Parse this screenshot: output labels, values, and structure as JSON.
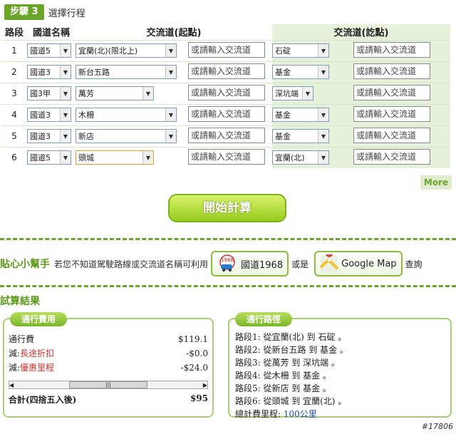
{
  "step": {
    "badge": "步驟 3",
    "title": "選擇行程"
  },
  "table": {
    "headers": {
      "segment": "路段",
      "road": "國道名稱",
      "start": "交流道(起點)",
      "end": "交流道(訖點)"
    },
    "placeholder": "或請輸入交流道",
    "rows": [
      {
        "num": "1",
        "road": "國道5",
        "start": "宜蘭(北)(限北上)",
        "end": "石碇"
      },
      {
        "num": "2",
        "road": "國道3",
        "start": "新台五路",
        "end": "基金"
      },
      {
        "num": "3",
        "road": "國3甲",
        "start": "萬芳",
        "end": "深坑端"
      },
      {
        "num": "4",
        "road": "國道3",
        "start": "木柵",
        "end": "基金"
      },
      {
        "num": "5",
        "road": "國道3",
        "start": "新店",
        "end": "基金"
      },
      {
        "num": "6",
        "road": "國道5",
        "start": "頭城",
        "end": "宜蘭(北)"
      }
    ]
  },
  "more": "More",
  "calc_button": "開始計算",
  "helper": {
    "title": "貼心小幫手",
    "text": "若您不知道駕駛路線或交流道名稱可利用",
    "btn1": "國道1968",
    "btn1_badge": "1968",
    "or": "或是",
    "btn2": "Google Map",
    "query": "查詢"
  },
  "results_title": "試算結果",
  "fee": {
    "tag": "通行費用",
    "rows": [
      {
        "label": "通行費",
        "label_prefix": "",
        "value": "$119.1"
      },
      {
        "label": "長途折扣",
        "label_prefix": "減:",
        "value": "-$0.0"
      },
      {
        "label": "優惠里程",
        "label_prefix": "減:",
        "value": "-$24.0"
      }
    ],
    "scroll_left": "◀",
    "scroll_thumb": "|||",
    "scroll_right": "▶",
    "total_label": "合計(四捨五入後)",
    "total_value": "$95"
  },
  "route": {
    "tag": "通行路徑",
    "lines": [
      "路段1: 從宜蘭(北) 到 石碇 。",
      "路段2: 從新台五路 到 基金 。",
      "路段3: 從萬芳 到 深坑端 。",
      "路段4: 從木柵 到 基金 。",
      "路段5: 從新店 到 基金 。",
      "路段6: 從頭城 到 宜蘭(北) 。"
    ],
    "total_label": "總計費里程: ",
    "total_value": "100公里"
  },
  "watermark": "#17806",
  "colors": {
    "accent": "#6aa52a",
    "dest_bg": "#e6f1dc",
    "red": "#cc3333"
  }
}
